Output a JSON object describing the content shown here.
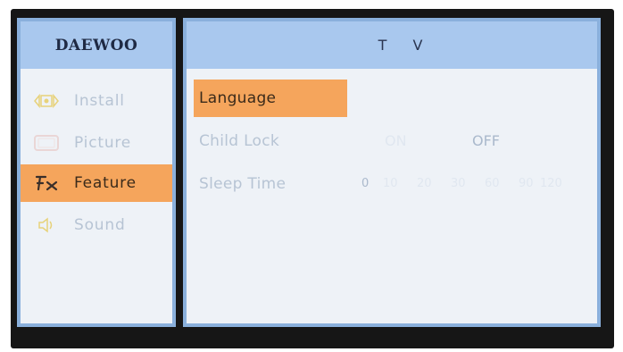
{
  "side_panel": {
    "brand": "DAEWOO",
    "items": [
      {
        "label": "Install",
        "icon": "install-icon",
        "selected": false
      },
      {
        "label": "Picture",
        "icon": "picture-icon",
        "selected": false
      },
      {
        "label": "Feature",
        "icon": "feature-fx-icon",
        "selected": true
      },
      {
        "label": "Sound",
        "icon": "speaker-icon",
        "selected": false
      }
    ]
  },
  "main_panel": {
    "title": "T V",
    "rows": [
      {
        "label": "Language",
        "selected": true
      },
      {
        "label": "Child Lock",
        "options": [
          "ON",
          "OFF"
        ],
        "current": "OFF"
      },
      {
        "label": "Sleep Time",
        "options": [
          "0",
          "10",
          "20",
          "30",
          "60",
          "90",
          "120"
        ],
        "current": "0"
      }
    ]
  },
  "colors": {
    "panel_border": "#8ab0dc",
    "header_bg": "#a9c8ee",
    "panel_bg": "#eef2f7",
    "highlight": "#f5a55c",
    "text_dim": "#b7c4d4",
    "text_faint": "#e0e7f0",
    "bezel": "#161616"
  }
}
